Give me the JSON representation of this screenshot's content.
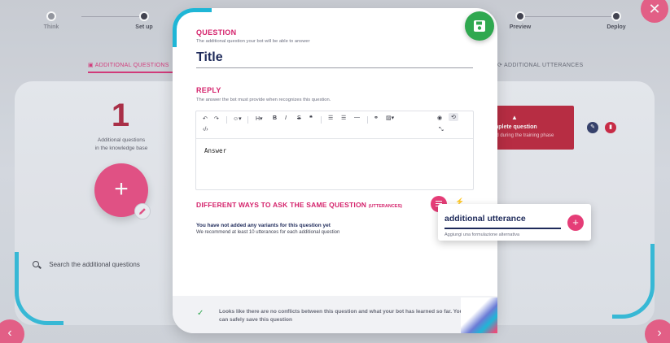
{
  "stepper": {
    "steps": [
      {
        "label": "Think"
      },
      {
        "label": "Set up"
      },
      {
        "label": "Preview"
      },
      {
        "label": "Deploy"
      }
    ]
  },
  "background": {
    "tab_left": "ADDITIONAL QUESTIONS",
    "tab_right": "ADDITIONAL UTTERANCES",
    "count": "1",
    "count_label_1": "Additional questions",
    "count_label_2": "in the knowledge base",
    "search_placeholder": "Search the additional questions",
    "card_title": "mplete question",
    "card_subtitle": "ed during the training phase"
  },
  "modal": {
    "question_heading": "QUESTION",
    "question_sub": "The additional question your bot will be able to answer",
    "question_value": "Title",
    "reply_heading": "REPLY",
    "reply_sub": "The answer the bot must provide when recognizes this question.",
    "reply_value": "Answer",
    "utt_heading": "DIFFERENT WAYS TO ASK THE SAME QUESTION",
    "utt_heading_small": "(UTTERANCES)",
    "empty_title": "You have not added any variants for this question yet",
    "empty_sub": "We recommend at least 10 utterances for each additional question",
    "footer_text": "Looks like there are no conflicts between this question and what your bot has learned so far. You can safely save this question"
  },
  "popover": {
    "value": "additional utterance",
    "hint": "Aggiungi una formulazione alternativa"
  },
  "colors": {
    "accent": "#d4226b",
    "pink": "#e53d77",
    "cyan": "#1fb6d6",
    "navy": "#1e2a5a",
    "green": "#2fa84f",
    "alert": "#b5122b"
  }
}
